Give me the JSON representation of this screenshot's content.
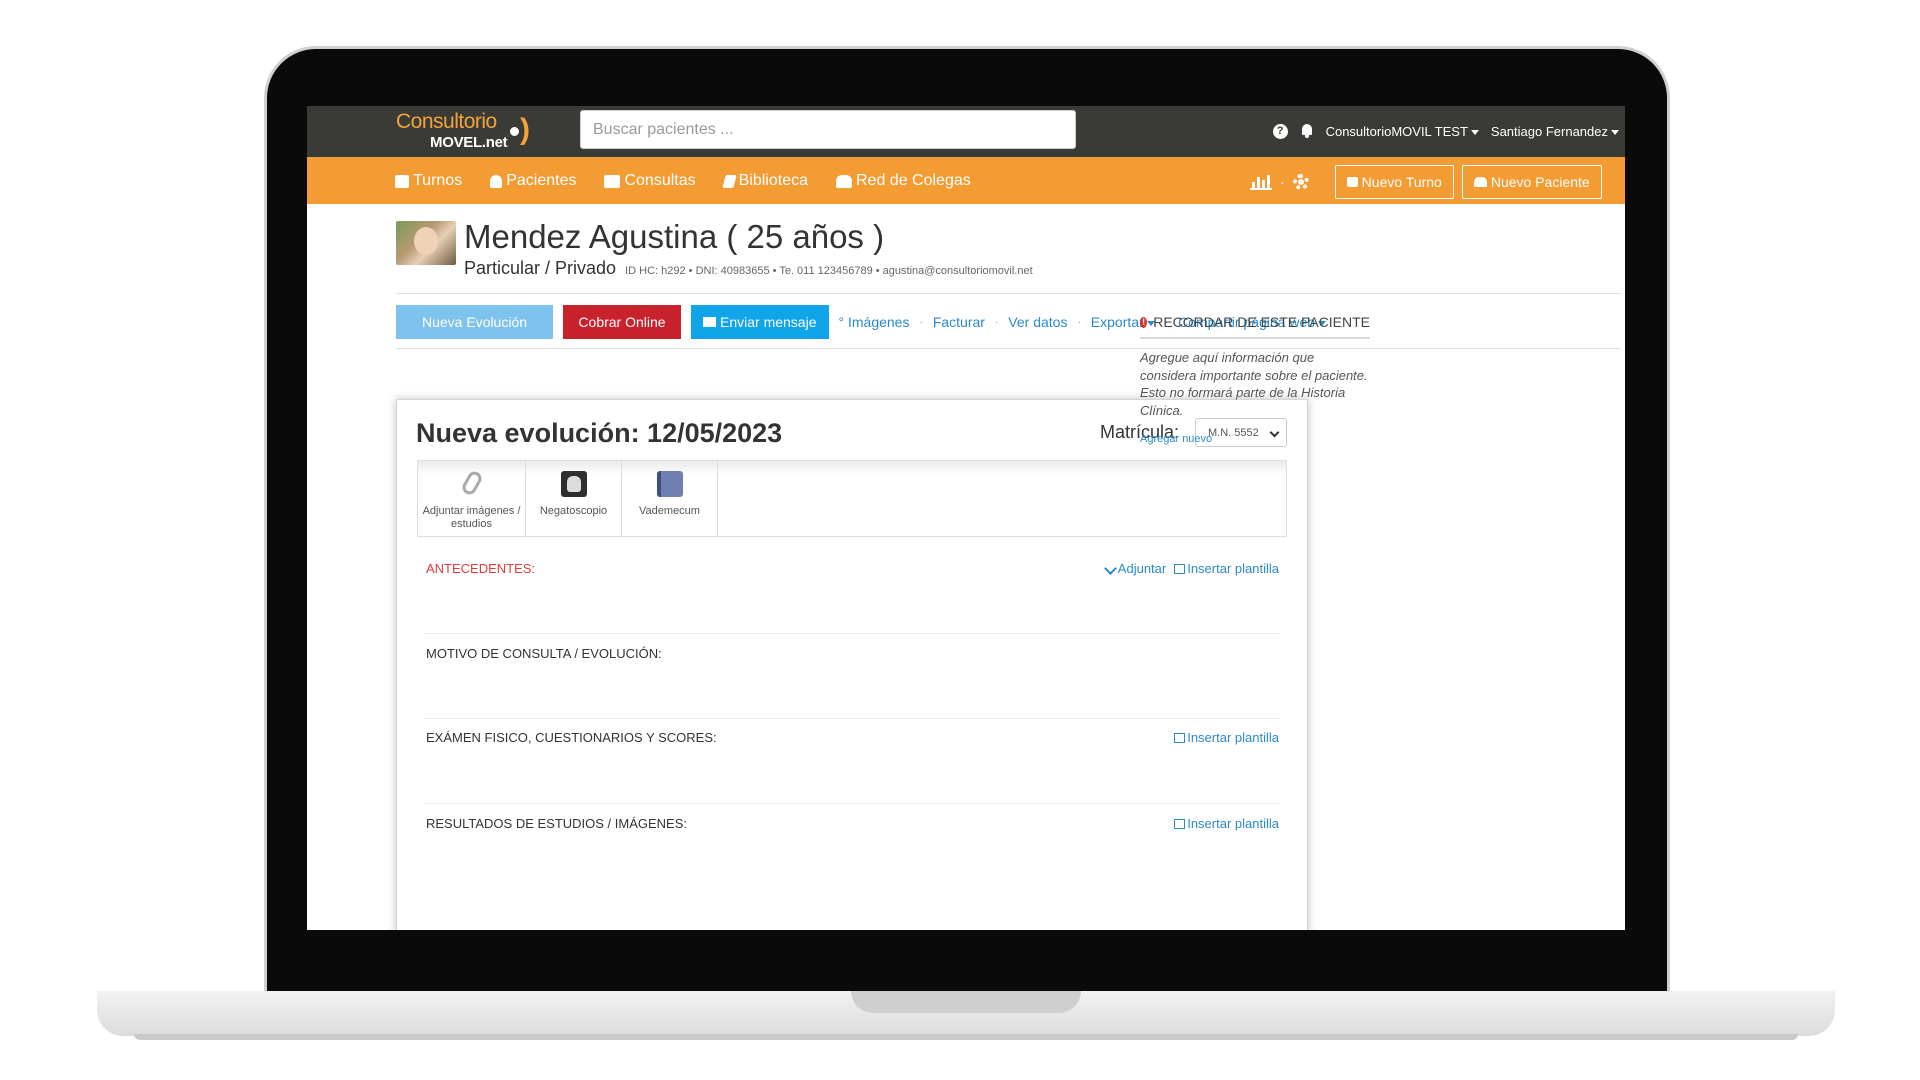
{
  "app": {
    "logo_line1": "Consultorio",
    "logo_line2": "MOVEL.net",
    "search_placeholder": "Buscar pacientes ...",
    "help_icon": "question-circle-icon",
    "notification_icon": "bell-icon",
    "account": "ConsultorioMOVIL TEST",
    "user": "Santiago Fernandez"
  },
  "nav": {
    "items": [
      {
        "label": "Turnos",
        "icon": "calendar-icon"
      },
      {
        "label": "Pacientes",
        "icon": "user-icon"
      },
      {
        "label": "Consultas",
        "icon": "consultation-icon"
      },
      {
        "label": "Biblioteca",
        "icon": "book-icon"
      },
      {
        "label": "Red de Colegas",
        "icon": "group-icon"
      }
    ],
    "dot_separator": "·",
    "nuevo_turno": "Nuevo Turno",
    "nuevo_paciente": "Nuevo Paciente"
  },
  "patient": {
    "name": "Mendez Agustina ( 25 años )",
    "coverage": "Particular / Privado",
    "meta": "ID HC: h292 • DNI: 40983655 • Te. 011 123456789 • agustina@consultoriomovil.net"
  },
  "actions": {
    "nueva_evolucion": "Nueva Evolución",
    "cobrar_online": "Cobrar Online",
    "enviar_mensaje": "Enviar mensaje",
    "links": [
      "° Imágenes",
      "Facturar",
      "Ver datos",
      "Exportar",
      "Compartir página web"
    ],
    "separator": "·"
  },
  "evolucion": {
    "title": "Nueva evolución: 12/05/2023",
    "matricula_label": "Matrícula:",
    "matricula_value": "M.N. 5552",
    "tools": [
      {
        "label": "Adjuntar imágenes / estudios",
        "icon": "paperclip-icon"
      },
      {
        "label": "Negatoscopio",
        "icon": "xray-hand-icon"
      },
      {
        "label": "Vademecum",
        "icon": "book-vademecum-icon"
      }
    ],
    "sections": [
      {
        "label": "ANTECEDENTES:",
        "adjuntar": "Adjuntar",
        "plantilla": "Insertar plantilla"
      },
      {
        "label": "MOTIVO DE CONSULTA / EVOLUCIÓN:"
      },
      {
        "label": "EXÁMEN FISICO, CUESTIONARIOS Y SCORES:",
        "plantilla": "Insertar plantilla"
      },
      {
        "label": "RESULTADOS DE ESTUDIOS / IMÁGENES:",
        "plantilla": "Insertar plantilla"
      }
    ]
  },
  "reminder": {
    "title": "RECORDAR DE ESTE PACIENTE",
    "text": "Agregue aquí información que considera importante sobre el paciente. Esto no formará parte de la Historia Clínica.",
    "link": "Agregar nuevo"
  },
  "colors": {
    "topbar": "#3a3a36",
    "navbar": "#f39c33",
    "accent_blue": "#10a4e8",
    "red": "#c8232c",
    "link": "#2b8ac8"
  }
}
